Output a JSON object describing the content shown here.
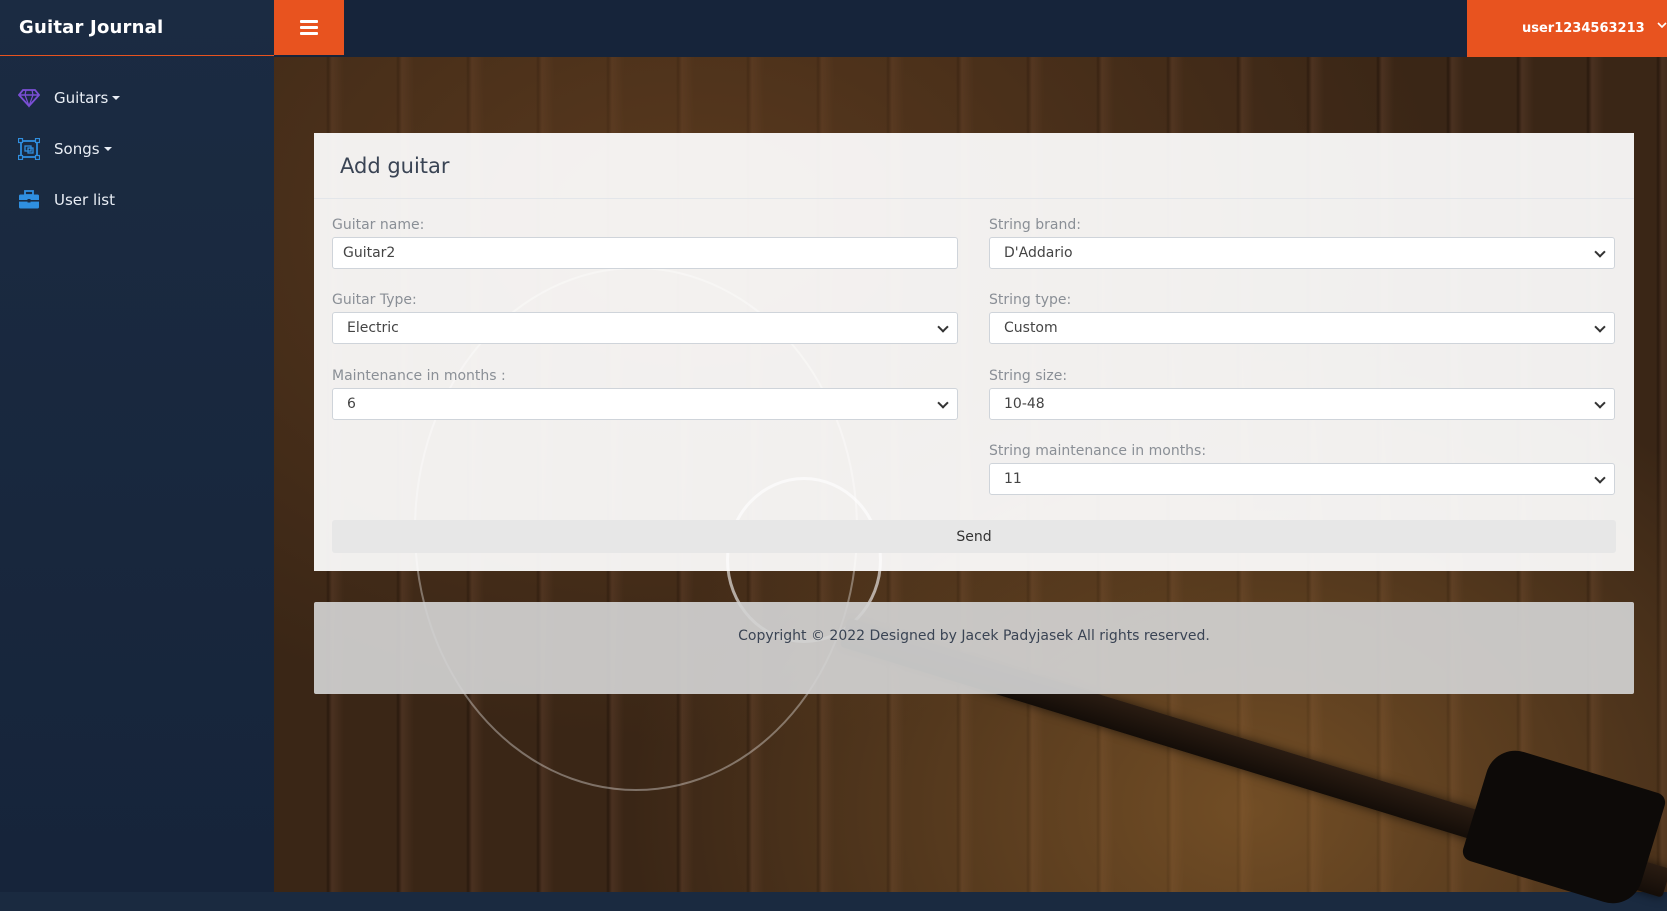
{
  "brand": {
    "title": "Guitar Journal"
  },
  "sidebar": {
    "items": [
      {
        "label": "Guitars",
        "icon": "diamond-icon",
        "dropdown": true
      },
      {
        "label": "Songs",
        "icon": "frame-icon",
        "dropdown": true
      },
      {
        "label": "User list",
        "icon": "briefcase-icon",
        "dropdown": false
      }
    ]
  },
  "topbar": {
    "user_label": "user1234563213"
  },
  "card": {
    "title": "Add guitar",
    "guitar_name": {
      "label": "Guitar name:",
      "value": "Guitar2"
    },
    "guitar_type": {
      "label": "Guitar Type:",
      "value": "Electric"
    },
    "maintenance": {
      "label": "Maintenance in months :",
      "value": "6"
    },
    "string_brand": {
      "label": "String brand:",
      "value": "D'Addario"
    },
    "string_type": {
      "label": "String type:",
      "value": "Custom"
    },
    "string_size": {
      "label": "String size:",
      "value": "10-48"
    },
    "string_maintenance": {
      "label": "String maintenance in months:",
      "value": "11"
    },
    "send_label": "Send"
  },
  "footer": {
    "text": "Copyright © 2022 Designed by Jacek Padyjasek All rights reserved."
  },
  "colors": {
    "accent": "#e8531f",
    "sidebar": "#1b2b42",
    "nav_icon_purple": "#7b4fd6",
    "nav_icon_blue": "#2f8fe0"
  }
}
